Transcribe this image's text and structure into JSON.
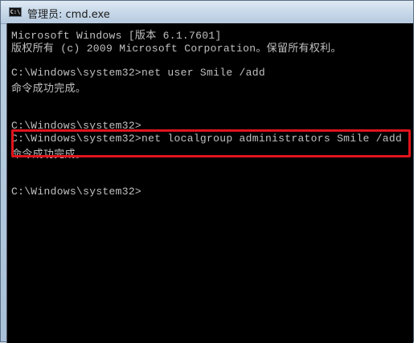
{
  "window": {
    "title": "管理员: cmd.exe",
    "icon": "cmd-icon",
    "icon_text": "C:\\"
  },
  "console": {
    "lines": [
      "Microsoft Windows [版本 6.1.7601]",
      "版权所有 (c) 2009 Microsoft Corporation。保留所有权利。",
      "",
      "C:\\Windows\\system32>net user Smile /add",
      "命令成功完成。",
      "",
      "",
      "C:\\Windows\\system32>",
      "C:\\Windows\\system32>net localgroup administrators Smile /add",
      "命令成功完成。",
      "",
      "",
      "C:\\Windows\\system32>"
    ]
  },
  "colors": {
    "background": "#000000",
    "text": "#c0c0c0",
    "highlight_border": "#e0141c"
  }
}
